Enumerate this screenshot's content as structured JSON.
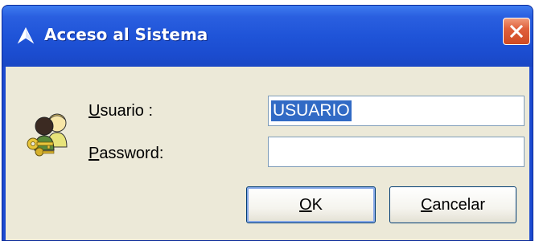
{
  "window": {
    "title": "Acceso al Sistema",
    "icon": "triangle-app-icon",
    "close_icon": "close-icon",
    "titlebar_color": "#1f54d8",
    "close_color": "#e0603c"
  },
  "form": {
    "user_label_mnemonic": "U",
    "user_label_rest": "suario :",
    "user_value": "USUARIO",
    "password_label_mnemonic": "P",
    "password_label_rest": "assword:",
    "password_value": "",
    "avatar_icon": "users-keys-icon"
  },
  "buttons": {
    "ok_mnemonic": "O",
    "ok_rest": "K",
    "cancel_mnemonic": "C",
    "cancel_rest": "ancelar"
  }
}
